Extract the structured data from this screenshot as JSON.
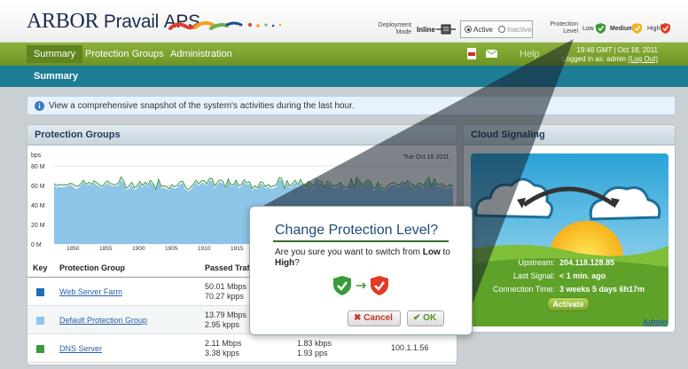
{
  "brand": {
    "name": "ARBOR",
    "product": "Pravail",
    "suffix": "APS"
  },
  "header": {
    "deployment_label_1": "Deployment",
    "deployment_label_2": "Mode",
    "deployment_mode": "Inline",
    "radio_active": "Active",
    "radio_inactive": "Inactive",
    "protection_label_1": "Protection",
    "protection_label_2": "Level",
    "levels": [
      "Low",
      "Medium",
      "High"
    ]
  },
  "nav": {
    "items": [
      "Summary",
      "Protection Groups",
      "Administration"
    ],
    "help": "Help",
    "datetime": "19:46 GMT | Oct 18, 2011",
    "logged_in_prefix": "Logged in as: admin",
    "logout": "(Log Out)"
  },
  "subnav": {
    "title": "Summary"
  },
  "info": {
    "text": "View a comprehensive snapshot of the system's activities during the last hour."
  },
  "protection_groups": {
    "title": "Protection Groups",
    "chart": {
      "unit": "bps",
      "date": "Tue Oct 18 2011",
      "y_ticks": [
        "80 M",
        "60 M",
        "40 M",
        "20 M",
        "0 M"
      ],
      "x_ticks": [
        "1850",
        "1855",
        "1900",
        "1905",
        "1910",
        "1915"
      ]
    },
    "columns": [
      "Key",
      "Protection Group",
      "Passed Traffi"
    ],
    "rows": [
      {
        "name": "Web Server Farm",
        "key_color": "#1b6fb4",
        "passed_1": "50.01 Mbps",
        "passed_2": "70.27 kpps",
        "c3_1": "",
        "c3_2": "",
        "c4": ""
      },
      {
        "name": "Default Protection Group",
        "key_color": "#8ec4e8",
        "passed_1": "13.79 Mbps",
        "passed_2": "2.95 kpps",
        "c3_1": "",
        "c3_2": "",
        "c4": ""
      },
      {
        "name": "DNS Server",
        "key_color": "#3a9a3a",
        "passed_1": "2.11 Mbps",
        "passed_2": "3.38 kpps",
        "c3_1": "1.83 kbps",
        "c3_2": "1.93 pps",
        "c4": "100.1.1.56"
      }
    ]
  },
  "cloud": {
    "title": "Cloud Signaling",
    "upstream_label": "Upstream:",
    "upstream_value": "204.118.128.85",
    "signal_label": "Last Signal:",
    "signal_value": "< 1 min. ago",
    "conn_label": "Connection Time:",
    "conn_value": "3 weeks 5 days 6h17m",
    "activate": "Activate",
    "admin": "Admin"
  },
  "dialog": {
    "title": "Change Protection Level?",
    "msg_1": "Are you sure you want to switch from",
    "from": "Low",
    "msg_to": "to",
    "to": "High",
    "msg_end": "?",
    "cancel": "Cancel",
    "ok": "OK"
  },
  "colors": {
    "nav_green": "#7ba531",
    "subnav_teal": "#1d7d94",
    "brand_navy": "#1d2b4f",
    "chart_blue": "#1b6fb4",
    "chart_light": "#8ec4e8",
    "chart_green": "#3a9a3a"
  }
}
